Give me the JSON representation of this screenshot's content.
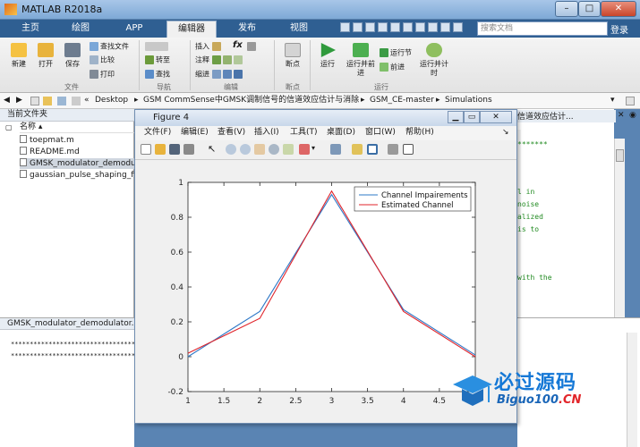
{
  "window": {
    "title": "MATLAB R2018a",
    "min_label": "–",
    "max_label": "□",
    "close_label": "✕"
  },
  "tabs": [
    {
      "label": "主页"
    },
    {
      "label": "绘图"
    },
    {
      "label": "APP"
    },
    {
      "label": "编辑器"
    },
    {
      "label": "发布"
    },
    {
      "label": "视图"
    }
  ],
  "search": {
    "placeholder": "搜索文档"
  },
  "login_label": "登录",
  "ribbon": {
    "groups": [
      "文件",
      "导航",
      "编辑",
      "断点",
      "运行"
    ],
    "file": {
      "new": "新建",
      "open": "打开",
      "save": "保存",
      "find_files": "查找文件",
      "compare": "比较",
      "print": "打印"
    },
    "nav": {
      "goto": "转至",
      "find": "查找"
    },
    "edit": {
      "insert": "插入",
      "comment": "注释",
      "indent": "缩进",
      "fx": "fx"
    },
    "breakpoints": {
      "label": "断点"
    },
    "run": {
      "run": "运行",
      "run_advance": "运行并前进",
      "run_section": "运行节",
      "advance": "前进",
      "run_time": "运行并计时"
    }
  },
  "path": {
    "segments": [
      "Desktop",
      "GSM CommSense中GMSK调制信号的信道效应估计与消除",
      "GSM_CE-master",
      "Simulations"
    ]
  },
  "current_folder": {
    "title": "当前文件夹",
    "column": "名称",
    "files": [
      {
        "name": "toepmat.m"
      },
      {
        "name": "README.md"
      },
      {
        "name": "GMSK_modulator_demodulator.m"
      },
      {
        "name": "gaussian_pulse_shaping_filter.m"
      }
    ]
  },
  "details": {
    "title": "GMSK_modulator_demodulator.m",
    "lines": [
      "*****************************************",
      "*****************************************"
    ]
  },
  "editor": {
    "tab_title": "信道效应估计...",
    "lines": [
      "*******",
      "l in",
      "noise",
      "alized",
      "is to",
      "with the"
    ]
  },
  "figure": {
    "title": "Figure 4",
    "menus": [
      "文件(F)",
      "编辑(E)",
      "查看(V)",
      "插入(I)",
      "工具(T)",
      "桌面(D)",
      "窗口(W)",
      "帮助(H)"
    ]
  },
  "chart_data": {
    "type": "line",
    "title": "",
    "xlabel": "",
    "ylabel": "",
    "xlim": [
      1,
      5
    ],
    "ylim": [
      -0.2,
      1
    ],
    "xticks": [
      1,
      1.5,
      2,
      2.5,
      3,
      3.5,
      4,
      4.5,
      5
    ],
    "yticks": [
      -0.2,
      0,
      0.2,
      0.4,
      0.6,
      0.8,
      1
    ],
    "grid": false,
    "legend_position": "top-right",
    "x": [
      1,
      2,
      3,
      4,
      5
    ],
    "series": [
      {
        "name": "Channel Impairements",
        "color": "#2e78c7",
        "values": [
          0.0,
          0.26,
          0.93,
          0.27,
          0.01
        ]
      },
      {
        "name": "Estimated Channel",
        "color": "#e0242b",
        "values": [
          0.02,
          0.22,
          0.95,
          0.26,
          0.0
        ]
      }
    ]
  },
  "watermark": {
    "main": "必过源码",
    "sub": "Biguo100",
    "suffix": ".CN"
  },
  "colors": {
    "tabbar": "#2f5f92",
    "accent_blue": "#2e78c7",
    "accent_red": "#e0242b"
  }
}
